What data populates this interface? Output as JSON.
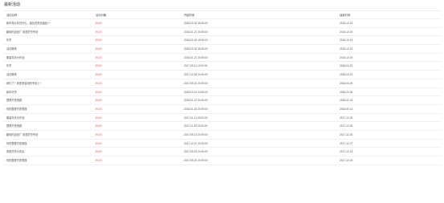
{
  "panel": {
    "title": "最新活动"
  },
  "table": {
    "columns": [
      "活动名称",
      "活动价格",
      "开始时间",
      "结束时间"
    ],
    "rows": [
      {
        "name": "新年特价年货好礼，福包送来送福品++",
        "value": "¥0.00",
        "start": "2018-02-03 15:00:00",
        "end": "2018-10-19"
      },
      {
        "name": "趣味的运营广·家居好货专场",
        "value": "¥0.00",
        "start": "2018-01-27 20:00:00",
        "end": "2018-10-19"
      },
      {
        "name": "年货",
        "value": "¥0.00",
        "start": "2018-02-03 15:00:00",
        "end": "2018-10-19"
      },
      {
        "name": "活动推荐",
        "value": "¥0.00",
        "start": "2018-02-03 15:00:00",
        "end": "2018-10-19"
      },
      {
        "name": "服装年货大作战",
        "value": "¥0.00",
        "start": "2018-01-27 20:00:00",
        "end": "2018-10-19"
      },
      {
        "name": "年货",
        "value": "¥0.00",
        "start": "2017-09-11 12:00:00",
        "end": "2018-04-23"
      },
      {
        "name": "活动推荐",
        "value": "¥0.00",
        "start": "2017-12-18 10:00:00",
        "end": "2018-04-23"
      },
      {
        "name": "我们了！家居家装特别专场上！",
        "value": "¥0.00",
        "start": "2017-09-02 20:00:00",
        "end": "2018-04-09"
      },
      {
        "name": "新年好货",
        "value": "¥0.00",
        "start": "2018-03-12 14:00:00",
        "end": "2018-03-30"
      },
      {
        "name": "整理不是难题",
        "value": "¥0.00",
        "start": "2018-01-27 20:00:00",
        "end": "2018-01-31"
      },
      {
        "name": "你的整理不是难题",
        "value": "¥0.00",
        "start": "2018-01-15 20:00:00",
        "end": "2018-01-14"
      },
      {
        "name": "服装年货大作战",
        "value": "¥0.00",
        "start": "2017-11-21 20:00:00",
        "end": "2017-12-30"
      },
      {
        "name": "整理不是难题",
        "value": "¥0.00",
        "start": "2017-11-29 20:00:00",
        "end": "2017-12-30"
      },
      {
        "name": "趣味的运营广·家居好货专场",
        "value": "¥0.00",
        "start": "2017-09-13 20:00:00",
        "end": "2017-12-30"
      },
      {
        "name": "你的整理不是难题",
        "value": "¥0.00",
        "start": "2017-12-07 20:00:00",
        "end": "2017-12-27"
      },
      {
        "name": "家居好货大赛会",
        "value": "¥0.00",
        "start": "2017-09-15 20:00:00",
        "end": "2017-12-14"
      },
      {
        "name": "你的整理不是难题",
        "value": "¥0.00",
        "start": "2017-09-20 20:00:00",
        "end": "2017-12-03"
      }
    ]
  },
  "colors": {
    "price": "#d9534f",
    "text": "#555555",
    "border": "#f0f0f0"
  }
}
